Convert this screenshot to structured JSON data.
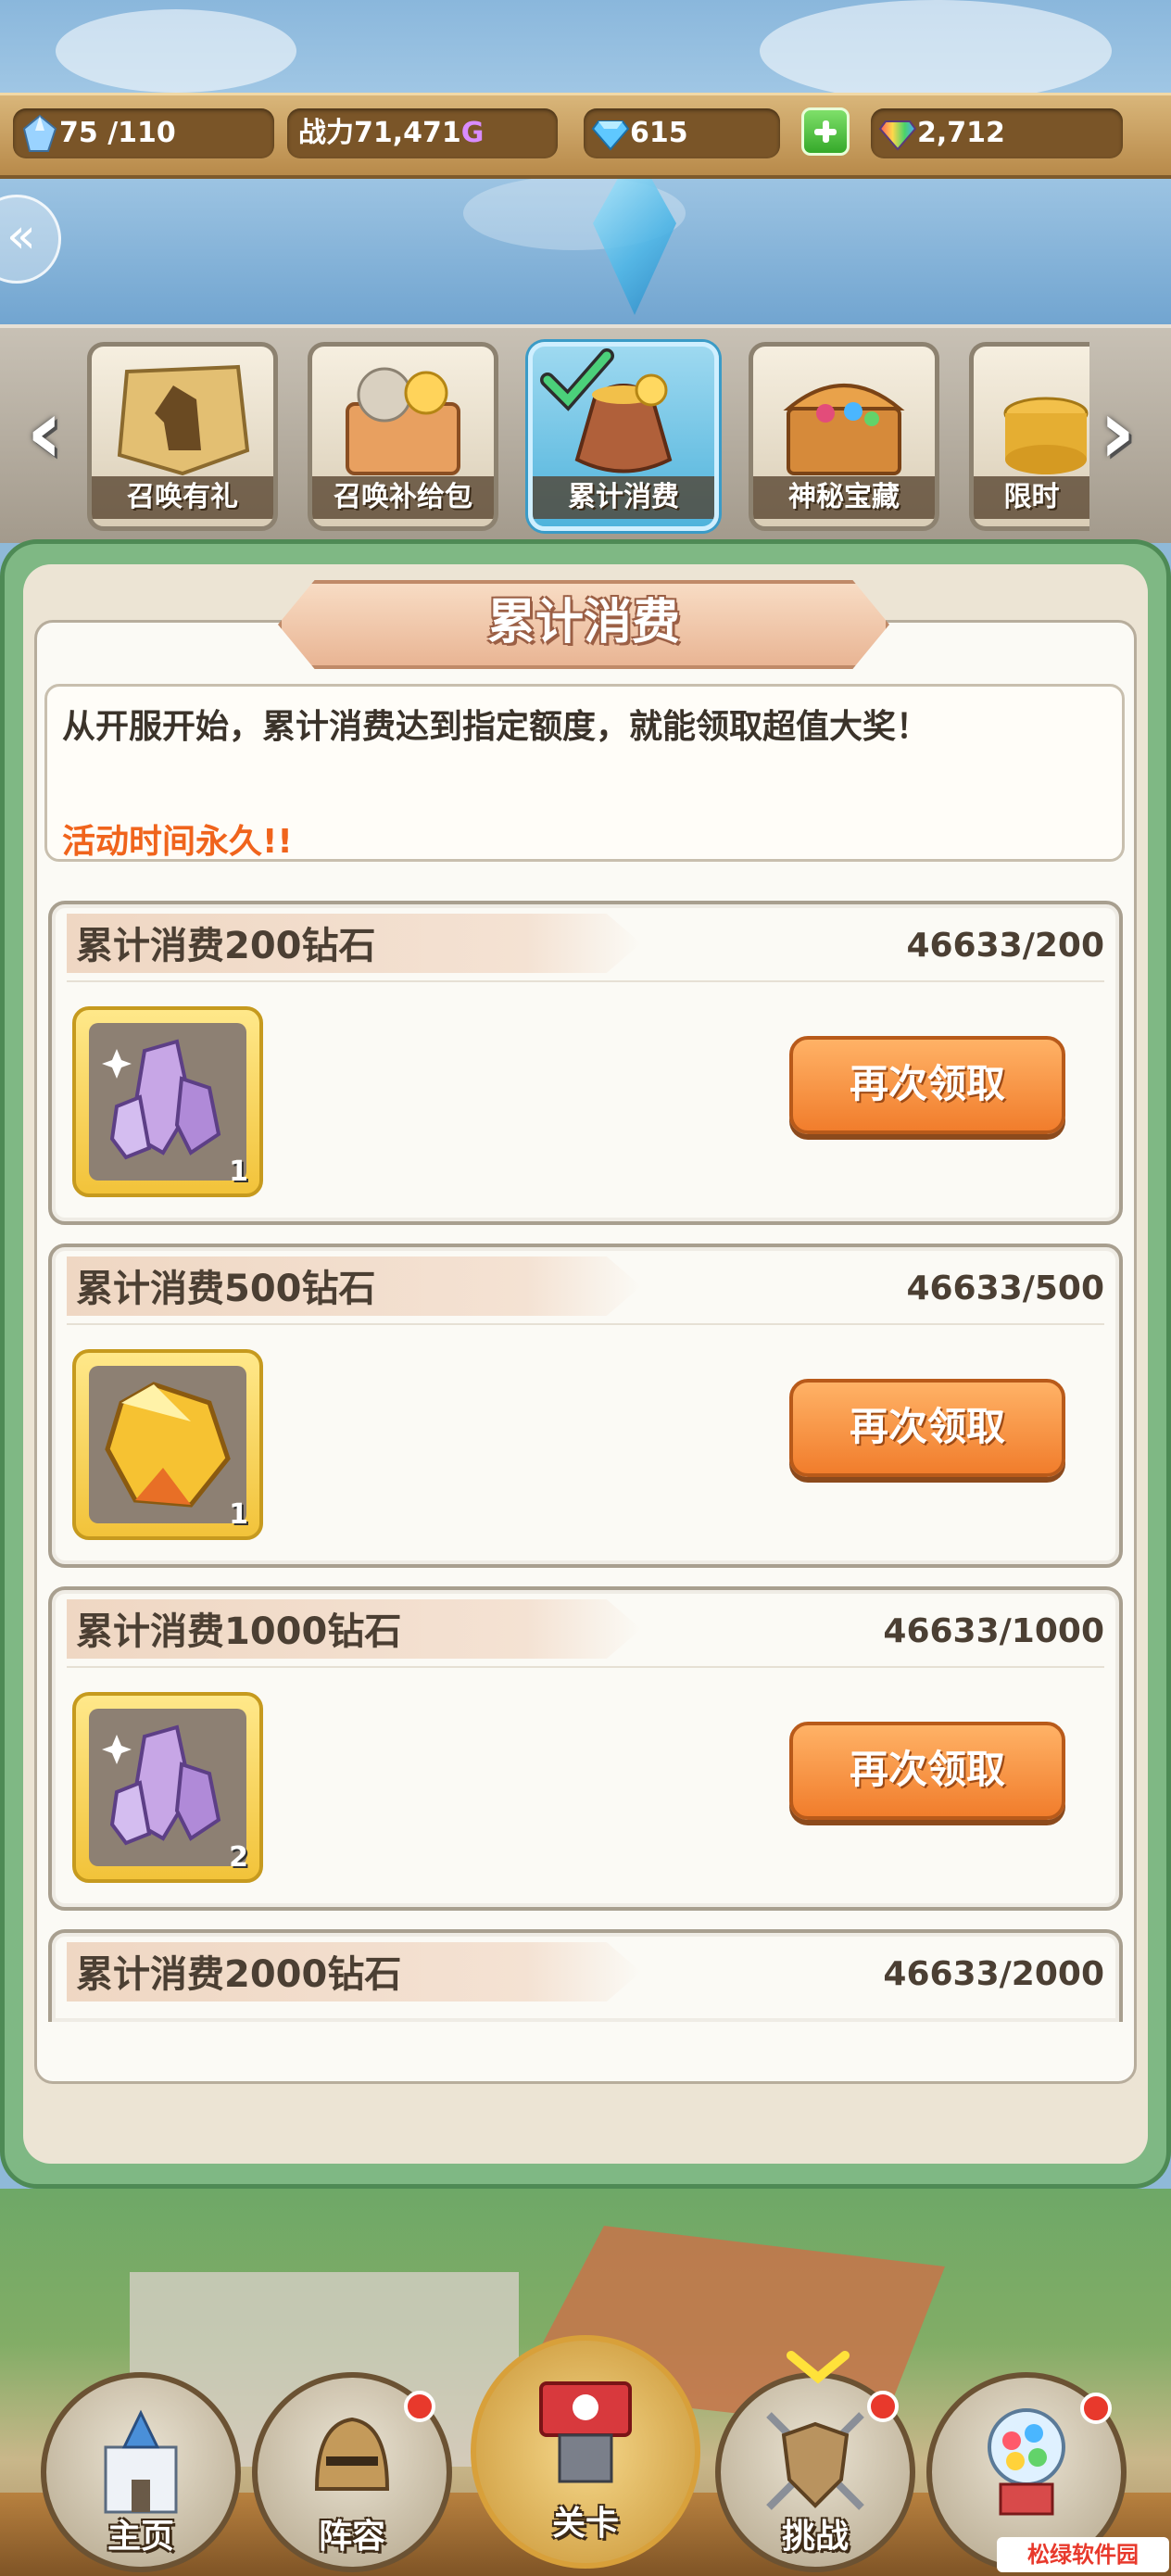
{
  "resources": {
    "stamina": "75 /110",
    "power": "战力71,471",
    "power_unit": "G",
    "diamonds": "615",
    "rainbow_gems": "2,712"
  },
  "tabs": [
    {
      "label": "召唤有礼",
      "active": false
    },
    {
      "label": "召唤补给包",
      "active": false
    },
    {
      "label": "累计消费",
      "active": true
    },
    {
      "label": "神秘宝藏",
      "active": false
    },
    {
      "label": "限时",
      "active": false
    }
  ],
  "panel": {
    "title": "累计消费",
    "description": "从开服开始，累计消费达到指定额度，就能领取超值大奖！",
    "duration": "活动时间永久!!"
  },
  "tasks": [
    {
      "title": "累计消费200钻石",
      "progress": "46633/200",
      "item": "purple-crystal",
      "qty": "1",
      "button": "再次领取"
    },
    {
      "title": "累计消费500钻石",
      "progress": "46633/500",
      "item": "gold-crystal",
      "qty": "1",
      "button": "再次领取"
    },
    {
      "title": "累计消费1000钻石",
      "progress": "46633/1000",
      "item": "purple-crystal",
      "qty": "2",
      "button": "再次领取"
    },
    {
      "title": "累计消费2000钻石",
      "progress": "46633/2000"
    }
  ],
  "nav": [
    {
      "label": "主页",
      "icon": "castle-icon",
      "badge": false
    },
    {
      "label": "阵容",
      "icon": "helmet-icon",
      "badge": true
    },
    {
      "label": "关卡",
      "icon": "tower-flag-icon",
      "badge": false
    },
    {
      "label": "挑战",
      "icon": "shield-swords-icon",
      "badge": true
    },
    {
      "label": "",
      "icon": "gacha-machine-icon",
      "badge": true
    }
  ],
  "watermark": "松绿软件园",
  "colors": {
    "accent_orange": "#f17d2c",
    "panel_green": "#7fb884",
    "highlight_orange_text": "#f0641c"
  }
}
